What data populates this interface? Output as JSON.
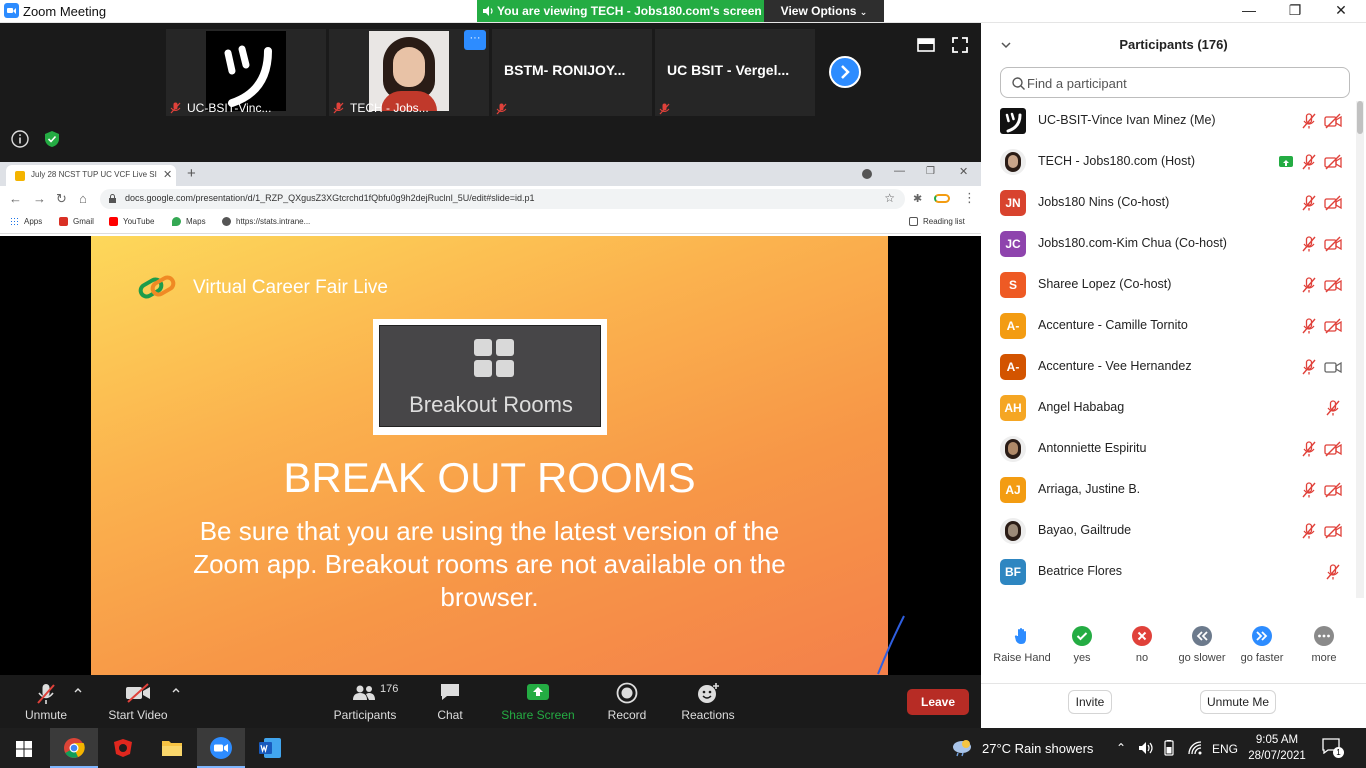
{
  "window": {
    "title": "Zoom Meeting",
    "share_banner": "You are viewing TECH - Jobs180.com's screen",
    "view_options": "View Options"
  },
  "video_strip": {
    "tiles": [
      {
        "name": "UC-BSIT-Vinc..."
      },
      {
        "name": "TECH - Jobs..."
      },
      {
        "name": "BSTM- RONIJOY..."
      },
      {
        "name": "UC BSIT - Vergel..."
      }
    ],
    "more_dots": "···"
  },
  "browser": {
    "tab_title": "July 28 NCST TUP UC VCF Live SI",
    "url": "docs.google.com/presentation/d/1_RZP_QXgusZ3XGtcrchd1fQbfu0g9h2dejRuclnl_5U/edit#slide=id.p1",
    "bookmarks": [
      "Apps",
      "Gmail",
      "YouTube",
      "Maps",
      "https://stats.intrane..."
    ],
    "reading_list": "Reading list"
  },
  "slide": {
    "brand": "Virtual Career Fair Live",
    "button_label": "Breakout Rooms",
    "headline": "BREAK OUT ROOMS",
    "body": "Be sure that you are using the latest version of the Zoom app. Breakout rooms are not available on the browser."
  },
  "toolbar": {
    "unmute": "Unmute",
    "start_video": "Start Video",
    "participants": "Participants",
    "participant_count": "176",
    "chat": "Chat",
    "share_screen": "Share Screen",
    "record": "Record",
    "reactions": "Reactions",
    "leave": "Leave"
  },
  "panel": {
    "title": "Participants (176)",
    "search_placeholder": "Find a participant",
    "participants": [
      {
        "name": "UC-BSIT-Vince Ivan Minez (Me)",
        "avatar": "logo",
        "color": "#111111",
        "video": "off"
      },
      {
        "name": "TECH - Jobs180.com (Host)",
        "avatar": "photo",
        "color": "#c9a58a",
        "video": "off",
        "sharing": true
      },
      {
        "name": "Jobs180 Nins (Co-host)",
        "avatar": "JN",
        "color": "#d8432e",
        "video": "off"
      },
      {
        "name": "Jobs180.com-Kim Chua (Co-host)",
        "avatar": "JC",
        "color": "#8e44ad",
        "video": "off"
      },
      {
        "name": "Sharee Lopez (Co-host)",
        "avatar": "S",
        "color": "#ee5a24",
        "video": "off"
      },
      {
        "name": "Accenture - Camille Tornito",
        "avatar": "A-",
        "color": "#f39c12",
        "video": "off"
      },
      {
        "name": "Accenture - Vee Hernandez",
        "avatar": "A-",
        "color": "#d35400",
        "video": "on"
      },
      {
        "name": "Angel Hababag",
        "avatar": "AH",
        "color": "#f5a623",
        "video": "none"
      },
      {
        "name": "Antonniette Espiritu",
        "avatar": "photo",
        "color": "#b08968",
        "video": "off"
      },
      {
        "name": "Arriaga, Justine B.",
        "avatar": "AJ",
        "color": "#f39c12",
        "video": "off"
      },
      {
        "name": "Bayao, Gailtrude",
        "avatar": "photo",
        "color": "#9c8a78",
        "video": "off"
      },
      {
        "name": "Beatrice Flores",
        "avatar": "BF",
        "color": "#2e86c1",
        "video": "none"
      }
    ],
    "reactions": [
      {
        "label": "Raise Hand",
        "icon": "hand-icon",
        "color": "#2d8cff"
      },
      {
        "label": "yes",
        "icon": "check-icon",
        "color": "#24ac43"
      },
      {
        "label": "no",
        "icon": "x-icon",
        "color": "#e0413a"
      },
      {
        "label": "go slower",
        "icon": "rewind-icon",
        "color": "#6c7a8c"
      },
      {
        "label": "go faster",
        "icon": "fast-forward-icon",
        "color": "#2d8cff"
      },
      {
        "label": "more",
        "icon": "more-icon",
        "color": "#8a8a8a"
      }
    ],
    "invite": "Invite",
    "unmute_me": "Unmute Me"
  },
  "taskbar": {
    "weather": "27°C  Rain showers",
    "language": "ENG",
    "time": "9:05 AM",
    "date": "28/07/2021",
    "notifications": "1"
  }
}
